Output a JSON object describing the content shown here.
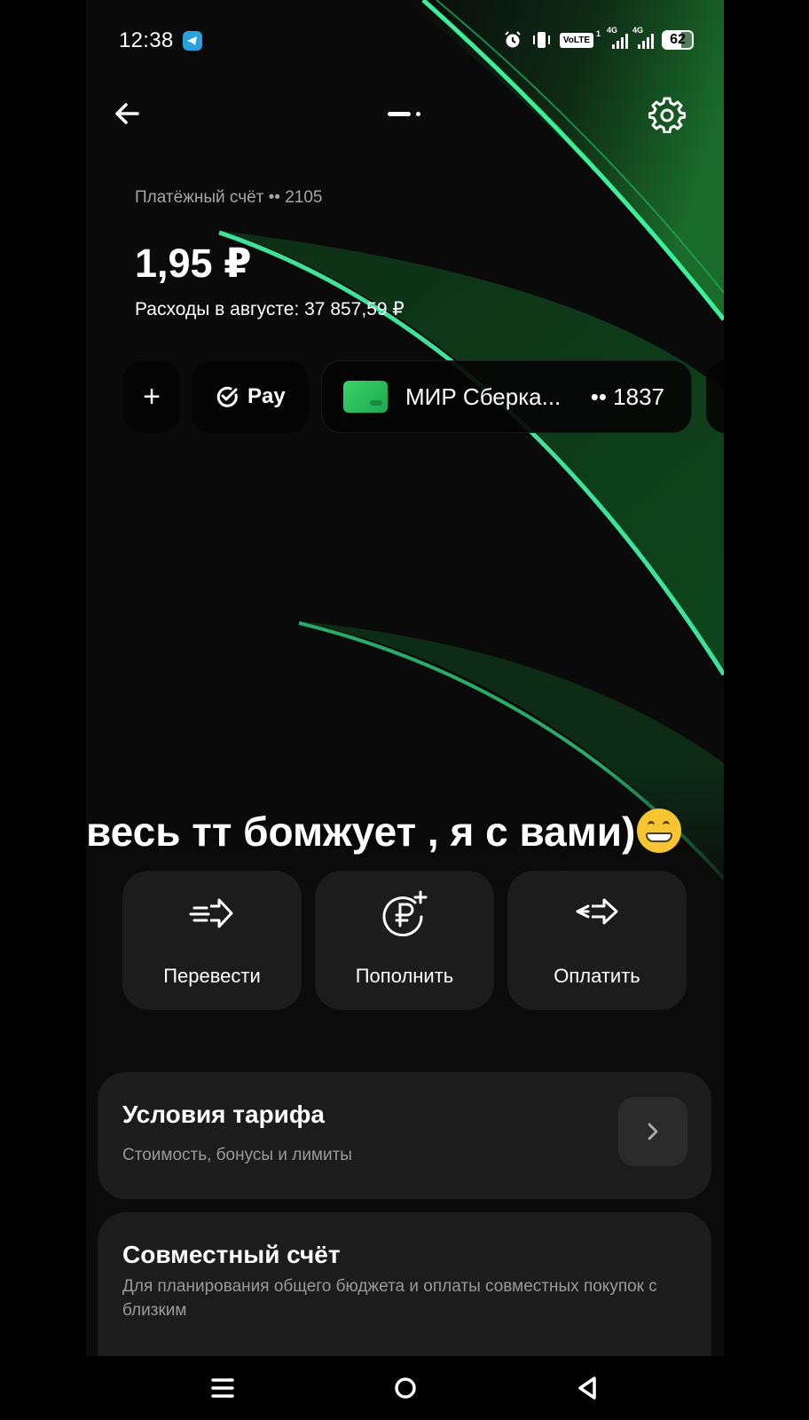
{
  "status_bar": {
    "time": "12:38",
    "volte": "VoLTE",
    "sim1_index": "1",
    "net1": "4G",
    "net2": "4G",
    "battery": "62",
    "battery_level_percent": 62,
    "icons": [
      "telegram-icon",
      "alarm-icon",
      "vibrate-icon",
      "volte-icon",
      "signal-icon",
      "signal-icon",
      "battery-icon"
    ]
  },
  "header": {
    "back_icon": "arrow-left-icon",
    "settings_icon": "gear-icon",
    "page_indicator": [
      "active",
      "inactive"
    ]
  },
  "account": {
    "label": "Платёжный счёт  •• 2105",
    "balance": "1,95 ₽",
    "spending": "Расходы в августе: 37 857,59 ₽"
  },
  "chips": {
    "add": "+",
    "pay": "Pay",
    "card_name": "МИР Сберка...",
    "card_number": "•• 1837"
  },
  "overlay_text": "весь тт бомжует , я с вами)",
  "actions": [
    {
      "label": "Перевести",
      "icon": "transfer-icon"
    },
    {
      "label": "Пополнить",
      "icon": "ruble-plus-icon"
    },
    {
      "label": "Оплатить",
      "icon": "pay-arrows-icon"
    }
  ],
  "tariff": {
    "title": "Условия тарифа",
    "subtitle": "Стоимость, бонусы и лимиты"
  },
  "joint": {
    "title": "Совместный счёт",
    "subtitle": "Для планирования общего бюджета и оплаты совместных покупок с близким"
  },
  "colors": {
    "accent_green": "#21c16b",
    "background": "#0b0b0b",
    "tile": "#1c1c1c"
  }
}
